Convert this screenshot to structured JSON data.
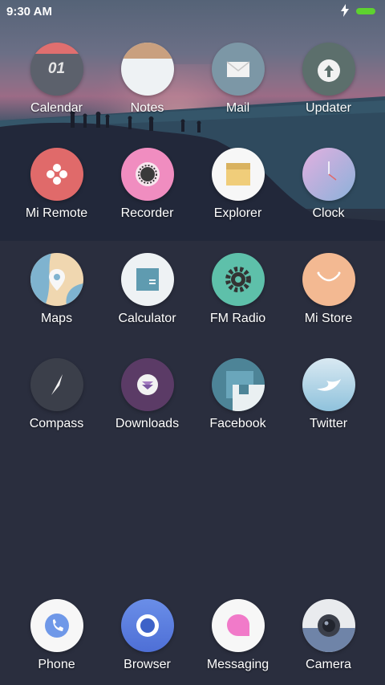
{
  "status_bar": {
    "time": "9:30 AM",
    "charging_icon": "lightning-bolt-icon",
    "battery_color": "#5ed22f"
  },
  "apps": [
    {
      "label": "Calendar",
      "icon": "calendar-icon",
      "date": "01"
    },
    {
      "label": "Notes",
      "icon": "notes-icon"
    },
    {
      "label": "Mail",
      "icon": "mail-icon"
    },
    {
      "label": "Updater",
      "icon": "updater-icon"
    },
    {
      "label": "Mi Remote",
      "icon": "remote-icon"
    },
    {
      "label": "Recorder",
      "icon": "recorder-icon"
    },
    {
      "label": "Explorer",
      "icon": "folder-icon"
    },
    {
      "label": "Clock",
      "icon": "clock-icon"
    },
    {
      "label": "Maps",
      "icon": "map-pin-icon"
    },
    {
      "label": "Calculator",
      "icon": "calculator-icon"
    },
    {
      "label": "FM Radio",
      "icon": "radio-gear-icon"
    },
    {
      "label": "Mi Store",
      "icon": "smile-bag-icon"
    },
    {
      "label": "Compass",
      "icon": "compass-icon"
    },
    {
      "label": "Downloads",
      "icon": "layers-download-icon"
    },
    {
      "label": "Facebook",
      "icon": "facebook-icon"
    },
    {
      "label": "Twitter",
      "icon": "bird-icon"
    }
  ],
  "dock": [
    {
      "label": "Phone",
      "icon": "phone-icon"
    },
    {
      "label": "Browser",
      "icon": "browser-icon"
    },
    {
      "label": "Messaging",
      "icon": "message-bubble-icon"
    },
    {
      "label": "Camera",
      "icon": "camera-lens-icon"
    }
  ]
}
